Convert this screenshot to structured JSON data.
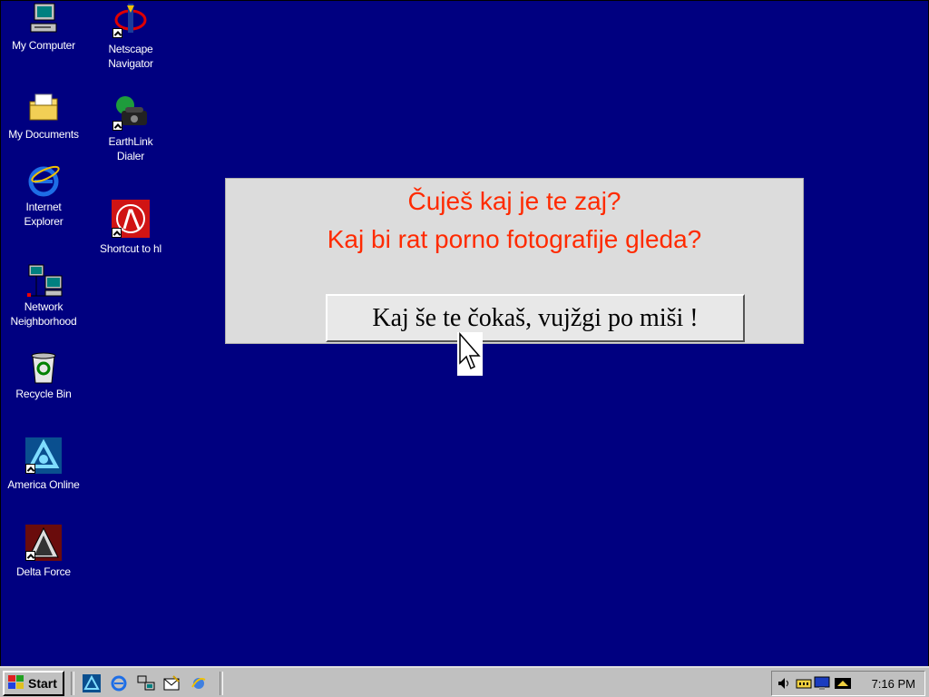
{
  "desktop": {
    "icons": [
      {
        "label": "My Computer",
        "icon": "my-computer-icon"
      },
      {
        "label": "My Documents",
        "icon": "my-documents-icon"
      },
      {
        "label": "Internet Explorer",
        "icon": "internet-explorer-icon"
      },
      {
        "label": "Network Neighborhood",
        "icon": "network-neighborhood-icon"
      },
      {
        "label": "Recycle Bin",
        "icon": "recycle-bin-icon"
      },
      {
        "label": "America Online",
        "icon": "america-online-icon"
      },
      {
        "label": "Delta Force",
        "icon": "delta-force-icon"
      },
      {
        "label": "Netscape Navigator",
        "icon": "netscape-navigator-icon"
      },
      {
        "label": "EarthLink Dialer",
        "icon": "earthlink-dialer-icon"
      },
      {
        "label": "Shortcut to hl",
        "icon": "half-life-icon"
      }
    ]
  },
  "dialog": {
    "line1": "Čuješ kaj je te zaj?",
    "line2": "Kaj bi rat porno fotografije  gleda?",
    "button_label": "Kaj še te čokaš, vujžgi po miši !",
    "text_color": "#ff2a00"
  },
  "taskbar": {
    "start_label": "Start",
    "clock": "7:16 PM",
    "quick_launch": [
      "aol-icon",
      "internet-explorer-icon",
      "network-icon",
      "outlook-icon",
      "channels-icon"
    ],
    "tray_icons": [
      "speaker-icon",
      "modem-icon",
      "monitor-icon",
      "display-icon"
    ]
  },
  "colors": {
    "desktop": "#000080",
    "taskbar": "#c0c0c0"
  }
}
